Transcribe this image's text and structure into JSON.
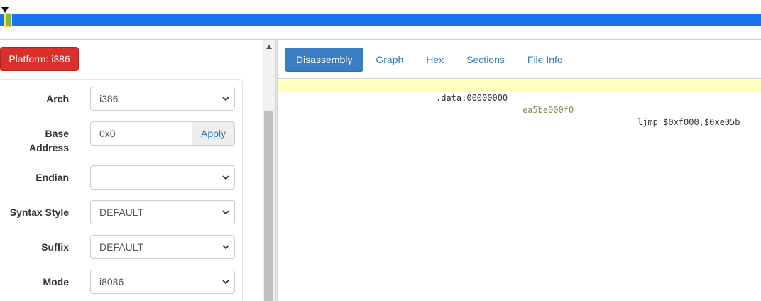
{
  "platform_button": {
    "label": "Platform: i386"
  },
  "settings": {
    "arch": {
      "label": "Arch",
      "value": "i386"
    },
    "base_address": {
      "label_line1": "Base",
      "label_line2": "Address",
      "value": "0x0",
      "apply_label": "Apply"
    },
    "endian": {
      "label": "Endian",
      "value": ""
    },
    "syntax_style": {
      "label": "Syntax Style",
      "value": "DEFAULT"
    },
    "suffix": {
      "label": "Suffix",
      "value": "DEFAULT"
    },
    "mode": {
      "label": "Mode",
      "value": "i8086"
    }
  },
  "tabs": [
    {
      "label": "Disassembly",
      "active": true
    },
    {
      "label": "Graph",
      "active": false
    },
    {
      "label": "Hex",
      "active": false
    },
    {
      "label": "Sections",
      "active": false
    },
    {
      "label": "File Info",
      "active": false
    }
  ],
  "disassembly": {
    "lines": [
      {
        "address": ".data:00000000",
        "bytes": "ea5be000f0",
        "instruction": "ljmp $0xf000,$0xe05b",
        "highlighted": true
      }
    ]
  },
  "colors": {
    "platform_button": "#d9302c",
    "nav_bar": "#1a73e8",
    "active_tab": "#3a7dc4",
    "highlight_line": "#ffffc0",
    "link": "#337ab7"
  }
}
